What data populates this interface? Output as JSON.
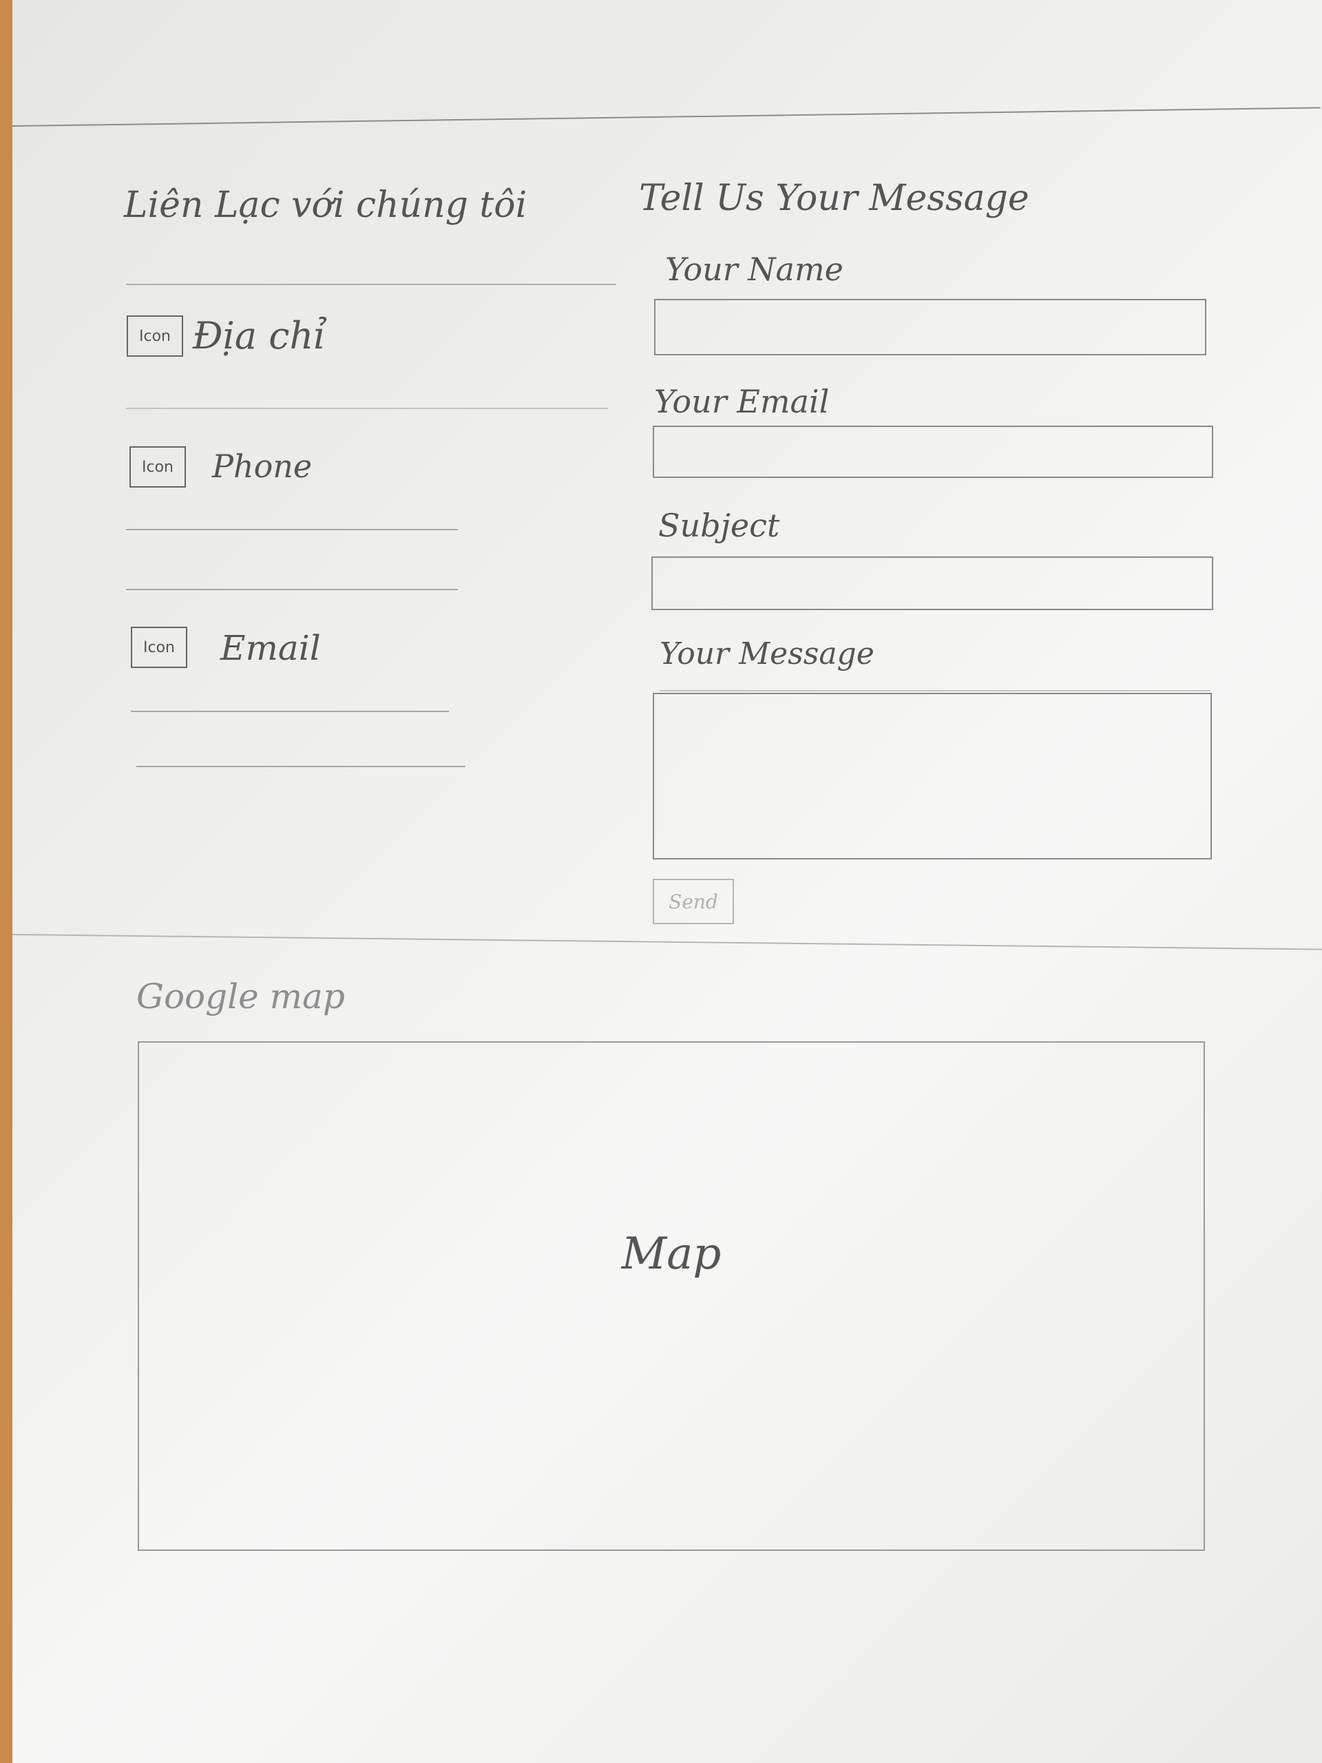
{
  "contact": {
    "title": "Liên Lạc với chúng tôi",
    "address_icon": "Icon",
    "address_label": "Địa chỉ",
    "phone_icon": "Icon",
    "phone_label": "Phone",
    "email_icon": "Icon",
    "email_label": "Email"
  },
  "form": {
    "title": "Tell Us Your Message",
    "name_label": "Your Name",
    "email_label": "Your Email",
    "subject_label": "Subject",
    "message_label": "Your Message",
    "send_label": "Send"
  },
  "map_section": {
    "title": "Google map",
    "placeholder": "Map"
  }
}
